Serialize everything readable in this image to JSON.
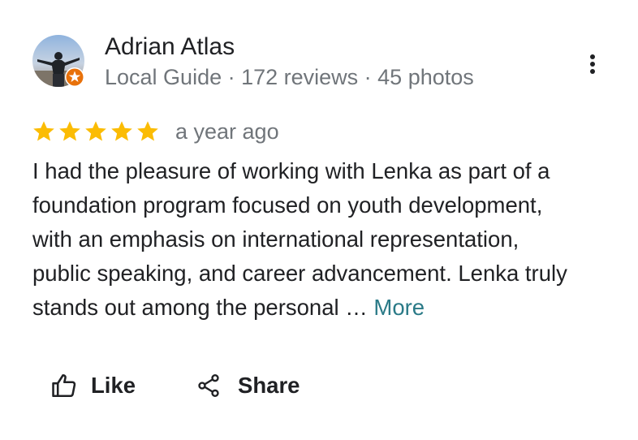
{
  "author": {
    "name": "Adrian Atlas",
    "meta": "Local Guide · 172 reviews · 45 photos",
    "avatar_icon": "user-photo-avatar",
    "badge_icon": "local-guide-star-badge",
    "badge_color": "#e8710a"
  },
  "review": {
    "rating": 5,
    "rating_max": 5,
    "star_color": "#fbbc04",
    "date": "a year ago",
    "text_lines": [
      "I had the pleasure of working with Lenka as part of a",
      "foundation program focused on youth development,",
      "with an emphasis on international representation,",
      "public speaking, and career advancement. Lenka truly",
      "stands out among the personal …"
    ],
    "more_label": "More",
    "more_color": "#2a7a87"
  },
  "actions": {
    "like_label": "Like",
    "share_label": "Share",
    "menu_icon": "more-vert-icon"
  }
}
